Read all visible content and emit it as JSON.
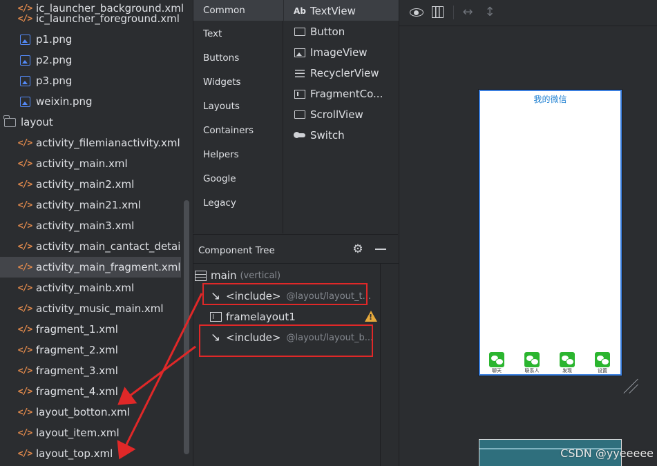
{
  "project_tree": {
    "items": [
      {
        "label": "ic_launcher_background.xml",
        "type": "xml"
      },
      {
        "label": "ic_launcher_foreground.xml",
        "type": "xml"
      },
      {
        "label": "p1.png",
        "type": "image"
      },
      {
        "label": "p2.png",
        "type": "image"
      },
      {
        "label": "p3.png",
        "type": "image"
      },
      {
        "label": "weixin.png",
        "type": "image"
      },
      {
        "label": "layout",
        "type": "folder"
      },
      {
        "label": "activity_filemianactivity.xml",
        "type": "xml"
      },
      {
        "label": "activity_main.xml",
        "type": "xml"
      },
      {
        "label": "activity_main2.xml",
        "type": "xml"
      },
      {
        "label": "activity_main21.xml",
        "type": "xml"
      },
      {
        "label": "activity_main3.xml",
        "type": "xml"
      },
      {
        "label": "activity_main_cantact_detail.xml",
        "type": "xml"
      },
      {
        "label": "activity_main_fragment.xml",
        "type": "xml",
        "selected": true
      },
      {
        "label": "activity_mainb.xml",
        "type": "xml"
      },
      {
        "label": "activity_music_main.xml",
        "type": "xml"
      },
      {
        "label": "fragment_1.xml",
        "type": "xml"
      },
      {
        "label": "fragment_2.xml",
        "type": "xml"
      },
      {
        "label": "fragment_3.xml",
        "type": "xml"
      },
      {
        "label": "fragment_4.xml",
        "type": "xml"
      },
      {
        "label": "layout_botton.xml",
        "type": "xml"
      },
      {
        "label": "layout_item.xml",
        "type": "xml"
      },
      {
        "label": "layout_top.xml",
        "type": "xml"
      }
    ]
  },
  "palette": {
    "categories": [
      "Common",
      "Text",
      "Buttons",
      "Widgets",
      "Layouts",
      "Containers",
      "Helpers",
      "Google",
      "Legacy"
    ],
    "active_category": "Common",
    "widgets": [
      {
        "label": "TextView",
        "icon": "textview-icon",
        "glyph": "Ab"
      },
      {
        "label": "Button",
        "icon": "button-icon"
      },
      {
        "label": "ImageView",
        "icon": "imageview-icon"
      },
      {
        "label": "RecyclerView",
        "icon": "recyclerview-icon"
      },
      {
        "label": "FragmentCo...",
        "icon": "fragment-container-icon"
      },
      {
        "label": "ScrollView",
        "icon": "scrollview-icon"
      },
      {
        "label": "Switch",
        "icon": "switch-icon"
      }
    ]
  },
  "component_tree": {
    "title": "Component Tree",
    "nodes": [
      {
        "label": "main",
        "sub": "(vertical)",
        "icon": "linear-layout-icon"
      },
      {
        "label": "<include>",
        "path": "@layout/layout_t...",
        "icon": "include-arrow-icon",
        "highlighted": true
      },
      {
        "label": "framelayout1",
        "icon": "framelayout-icon",
        "warning": true
      },
      {
        "label": "<include>",
        "path": "@layout/layout_b...",
        "icon": "include-arrow-icon",
        "highlighted": true
      }
    ]
  },
  "design": {
    "preview_title": "我的微信",
    "bottom_nav": [
      "聊天",
      "联系人",
      "发现",
      "设置"
    ]
  },
  "watermark": "CSDN @yyeeeee",
  "colors": {
    "background": "#2b2d30",
    "selection": "#43454a",
    "xml_icon": "#e0894c",
    "image_icon": "#548af7",
    "annotation_red": "#e02828",
    "preview_title": "#1d7fd1",
    "wechat_green": "#2bb52f",
    "warning": "#e6a93b"
  }
}
